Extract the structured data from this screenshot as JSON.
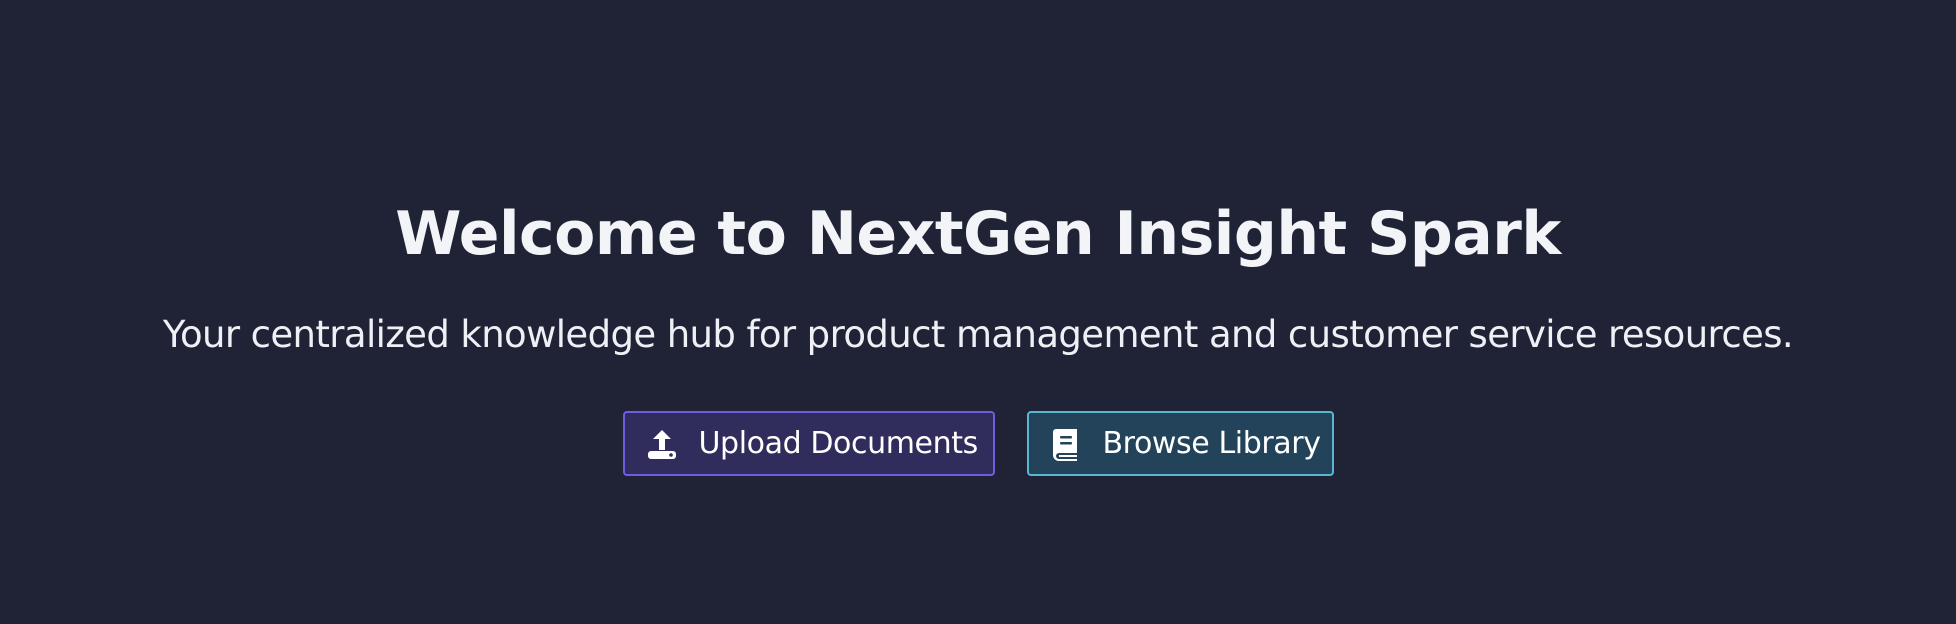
{
  "hero": {
    "title": "Welcome to NextGen Insight Spark",
    "subtitle": "Your centralized knowledge hub for product management and customer service resources."
  },
  "actions": {
    "upload": {
      "label": "Upload Documents",
      "icon": "upload-icon",
      "border_color": "#6f5ce0"
    },
    "browse": {
      "label": "Browse Library",
      "icon": "book-icon",
      "border_color": "#58b8cf"
    }
  },
  "theme": {
    "background": "#1f2335"
  }
}
